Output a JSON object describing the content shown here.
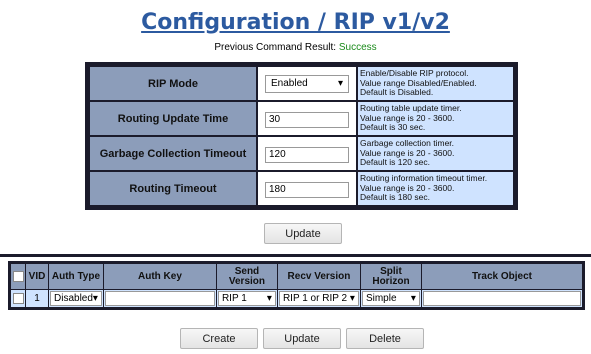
{
  "page": {
    "title": "Configuration / RIP v1/v2",
    "status_label": "Previous Command Result: ",
    "status_value": "Success"
  },
  "config": {
    "rip_mode": {
      "label": "RIP Mode",
      "value": "Enabled",
      "desc": [
        "Enable/Disable RIP protocol.",
        "Value range Disabled/Enabled.",
        "Default is Disabled."
      ]
    },
    "update_time": {
      "label": "Routing Update Time",
      "value": "30",
      "desc": [
        "Routing table update timer.",
        "Value range is 20 - 3600.",
        "Default is 30 sec."
      ]
    },
    "garbage_timeout": {
      "label": "Garbage Collection Timeout",
      "value": "120",
      "desc": [
        "Garbage collection timer.",
        "Value range is 20 - 3600.",
        "Default is 120 sec."
      ]
    },
    "routing_timeout": {
      "label": "Routing Timeout",
      "value": "180",
      "desc": [
        "Routing information timeout timer.",
        "Value range is 20 - 3600.",
        "Default is 180 sec."
      ]
    },
    "update_button": "Update"
  },
  "interfaces": {
    "headers": {
      "vid": "VID",
      "auth_type": "Auth Type",
      "auth_key": "Auth Key",
      "send_version": "Send Version",
      "recv_version": "Recv Version",
      "split_horizon": "Split Horizon",
      "track_object": "Track Object"
    },
    "row": {
      "vid": "1",
      "auth_type": "Disabled",
      "auth_key": "",
      "send_version": "RIP 1",
      "recv_version": "RIP 1 or RIP 2",
      "split_horizon": "Simple",
      "track_object": ""
    },
    "buttons": {
      "create": "Create",
      "update": "Update",
      "delete": "Delete"
    }
  }
}
